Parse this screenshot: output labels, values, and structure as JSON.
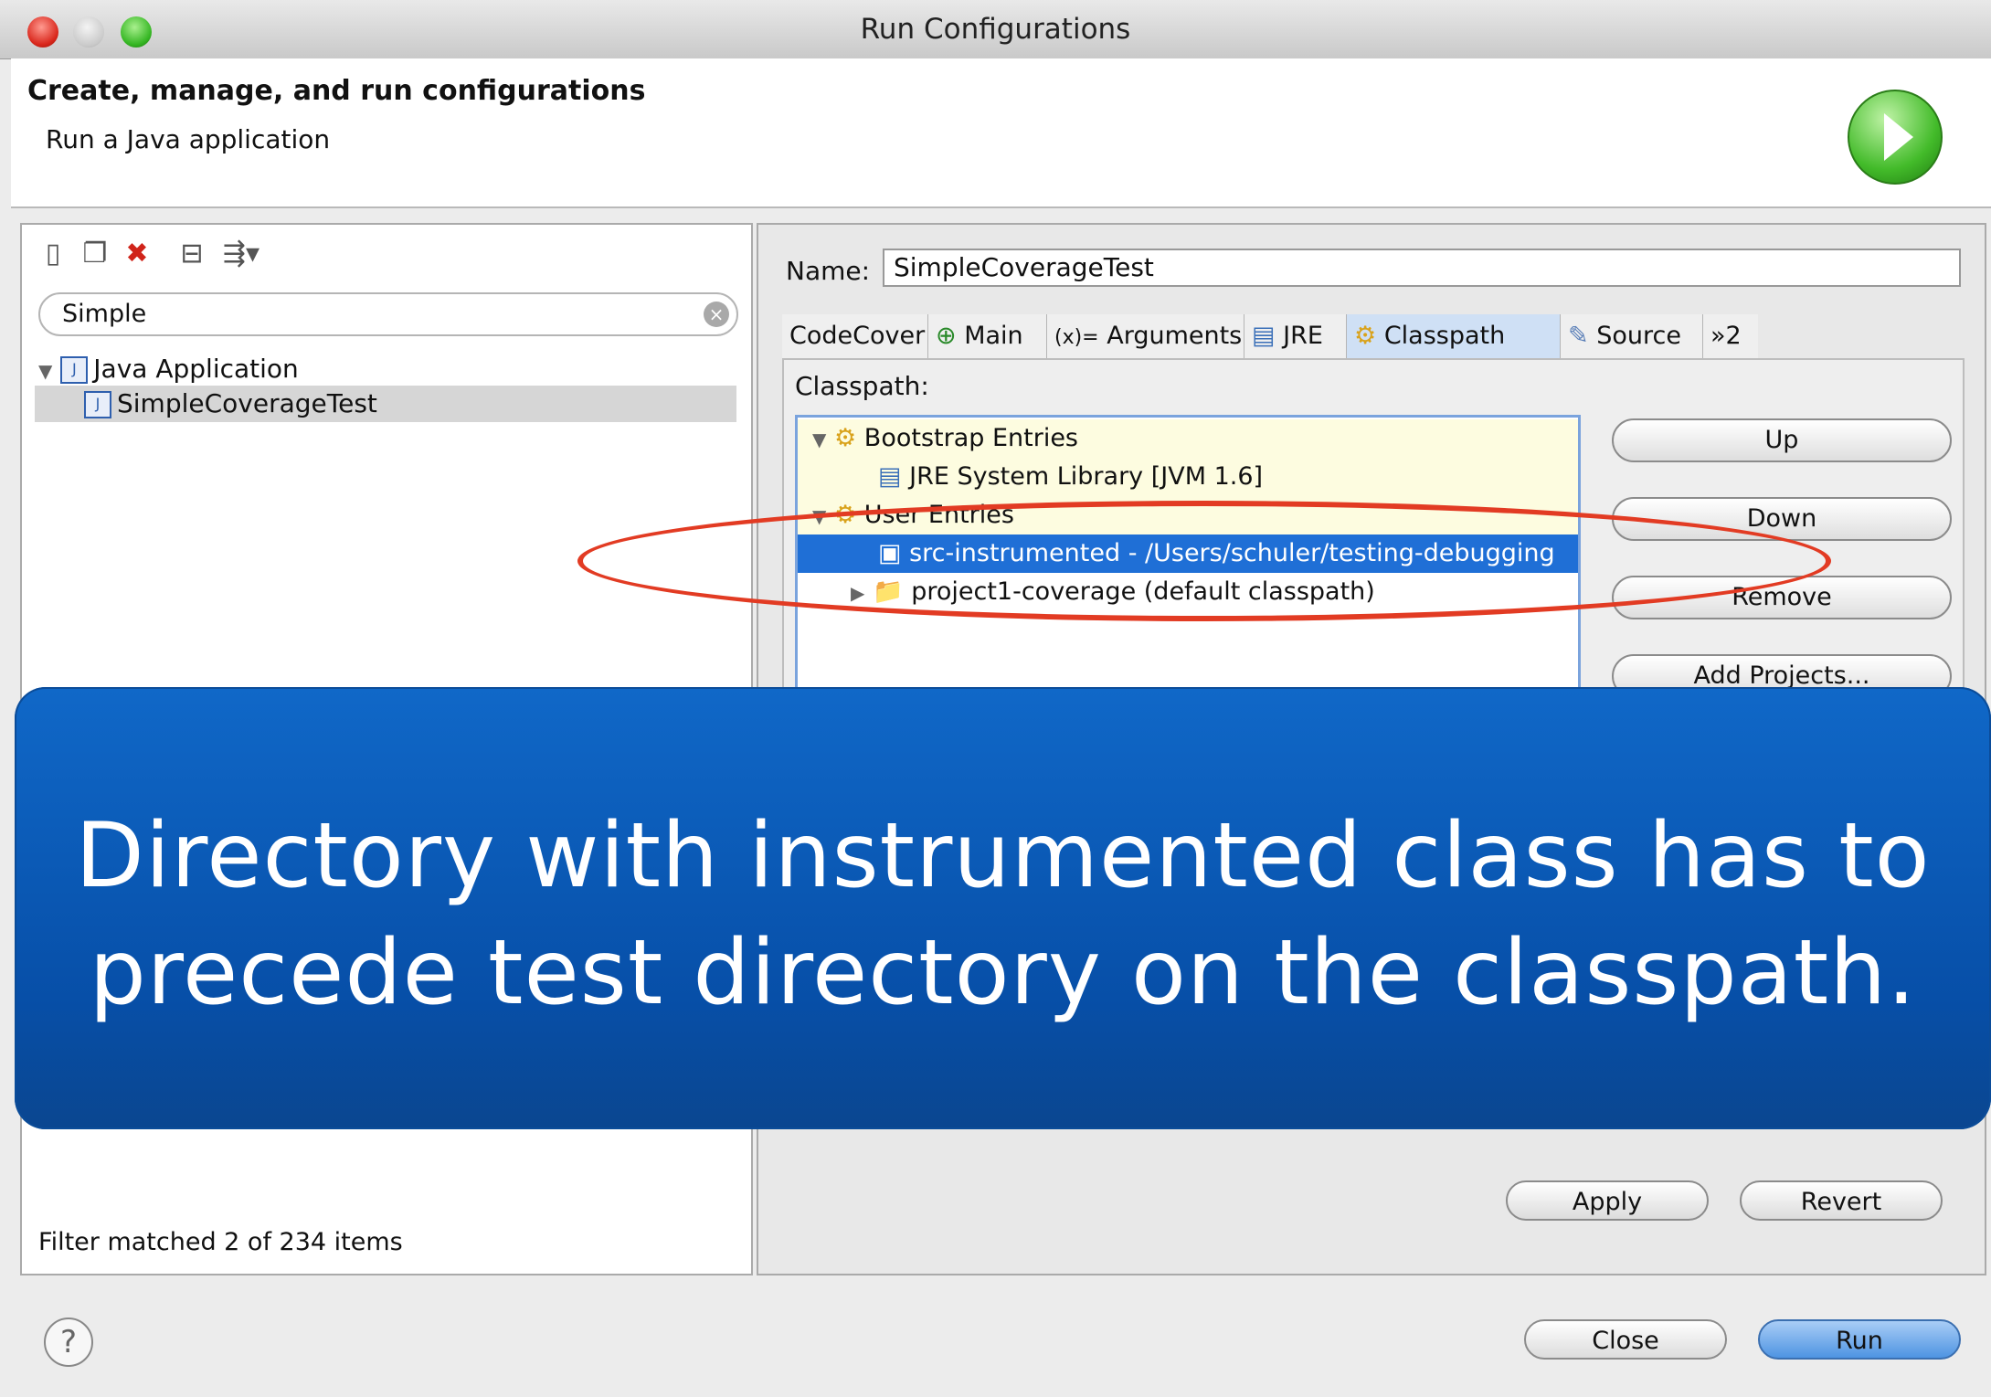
{
  "window": {
    "title": "Run Configurations"
  },
  "header": {
    "title": "Create, manage, and run configurations",
    "subtitle": "Run a Java application"
  },
  "left_panel": {
    "filter_value": "Simple",
    "tree": [
      {
        "label": "Java Application",
        "level": 0,
        "expanded": true
      },
      {
        "label": "SimpleCoverageTest",
        "level": 1,
        "selected": true
      }
    ],
    "status": "Filter matched 2 of 234 items"
  },
  "right_panel": {
    "name_label": "Name:",
    "name_value": "SimpleCoverageTest",
    "tabs": [
      {
        "label": "CodeCover"
      },
      {
        "label": "Main",
        "icon": "main-icon"
      },
      {
        "label": "Arguments",
        "icon": "arguments-icon",
        "prefix": "(x)="
      },
      {
        "label": "JRE",
        "icon": "jre-icon"
      },
      {
        "label": "Classpath",
        "icon": "classpath-icon",
        "active": true
      },
      {
        "label": "Source",
        "icon": "source-icon"
      },
      {
        "label": "»2"
      }
    ],
    "classpath_label": "Classpath:",
    "classpath_entries": [
      {
        "label": "Bootstrap Entries"
      },
      {
        "label": "JRE System Library [JVM 1.6]"
      },
      {
        "label": "User Entries"
      },
      {
        "label": "src-instrumented - /Users/schuler/testing-debugging"
      },
      {
        "label": "project1-coverage (default classpath)"
      }
    ],
    "side_buttons": {
      "up": "Up",
      "down": "Down",
      "remove": "Remove",
      "add_projects": "Add Projects..."
    },
    "apply": "Apply",
    "revert": "Revert"
  },
  "footer": {
    "close": "Close",
    "run": "Run",
    "help_glyph": "?"
  },
  "callout": {
    "line1": "Directory with instrumented class has to",
    "line2": "precede test directory on the classpath."
  },
  "colors": {
    "accent_selection": "#1f6fd6",
    "callout_bg": "#074fa8",
    "highlight_ellipse": "#e23b23"
  }
}
